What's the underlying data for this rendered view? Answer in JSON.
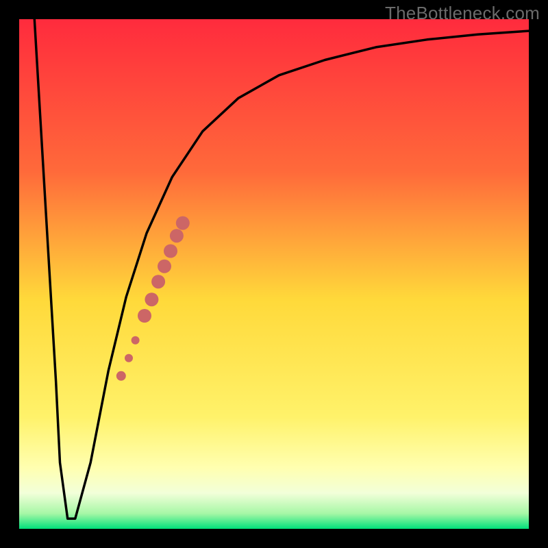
{
  "watermark": "TheBottleneck.com",
  "chart_data": {
    "type": "line",
    "title": "",
    "xlabel": "",
    "ylabel": "",
    "xlim": [
      0,
      1
    ],
    "ylim": [
      0,
      1
    ],
    "grid": false,
    "background_gradient": {
      "stops": [
        {
          "offset": 0.0,
          "color": "#ff2b3d"
        },
        {
          "offset": 0.3,
          "color": "#ff6a3a"
        },
        {
          "offset": 0.55,
          "color": "#ffd93a"
        },
        {
          "offset": 0.78,
          "color": "#fff26a"
        },
        {
          "offset": 0.88,
          "color": "#ffffb0"
        },
        {
          "offset": 0.93,
          "color": "#f2ffd9"
        },
        {
          "offset": 0.97,
          "color": "#a6f7a6"
        },
        {
          "offset": 1.0,
          "color": "#00e07a"
        }
      ]
    },
    "series": [
      {
        "name": "curve-left-descent",
        "x": [
          0.03,
          0.072,
          0.08,
          0.095,
          0.11
        ],
        "y": [
          1.0,
          0.29,
          0.13,
          0.02,
          0.02
        ]
      },
      {
        "name": "curve-right-ascent",
        "x": [
          0.11,
          0.14,
          0.175,
          0.21,
          0.25,
          0.3,
          0.36,
          0.43,
          0.51,
          0.6,
          0.7,
          0.8,
          0.9,
          1.0
        ],
        "y": [
          0.02,
          0.13,
          0.31,
          0.455,
          0.58,
          0.69,
          0.78,
          0.845,
          0.89,
          0.92,
          0.945,
          0.96,
          0.97,
          0.977
        ]
      }
    ],
    "scatter": {
      "name": "highlighted-segment-markers",
      "color": "#cc6666",
      "points": [
        {
          "x": 0.2,
          "y": 0.3,
          "r": 7
        },
        {
          "x": 0.215,
          "y": 0.335,
          "r": 6
        },
        {
          "x": 0.228,
          "y": 0.37,
          "r": 6
        },
        {
          "x": 0.246,
          "y": 0.418,
          "r": 10
        },
        {
          "x": 0.26,
          "y": 0.45,
          "r": 10
        },
        {
          "x": 0.273,
          "y": 0.485,
          "r": 10
        },
        {
          "x": 0.285,
          "y": 0.515,
          "r": 10
        },
        {
          "x": 0.297,
          "y": 0.545,
          "r": 10
        },
        {
          "x": 0.309,
          "y": 0.575,
          "r": 10
        },
        {
          "x": 0.321,
          "y": 0.6,
          "r": 10
        }
      ]
    }
  }
}
